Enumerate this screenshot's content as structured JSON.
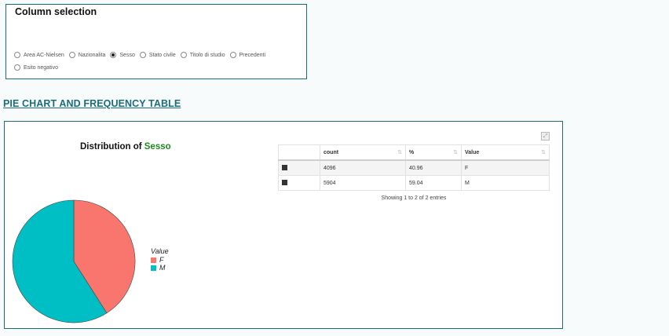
{
  "column_selection": {
    "title": "Column selection",
    "options": [
      {
        "label": "Area AC-Nielsen",
        "selected": false
      },
      {
        "label": "Nazionalita",
        "selected": false
      },
      {
        "label": "Sesso",
        "selected": true
      },
      {
        "label": "Stato civile",
        "selected": false
      },
      {
        "label": "Titolo di studio",
        "selected": false
      },
      {
        "label": "Precedenti",
        "selected": false
      },
      {
        "label": "Esito negativo",
        "selected": false
      }
    ]
  },
  "section_title": "PIE CHART AND FREQUENCY TABLE",
  "chart": {
    "title_prefix": "Distribution of ",
    "title_var": "Sesso",
    "legend_title": "Value",
    "expand_icon": "expand-icon"
  },
  "chart_data": {
    "type": "pie",
    "title": "Distribution of Sesso",
    "legend_title": "Value",
    "legend_placement": "right",
    "slices": [
      {
        "label": "F",
        "value": 4096,
        "percent": 40.96,
        "color": "#f8766d"
      },
      {
        "label": "M",
        "value": 5904,
        "percent": 59.04,
        "color": "#00bfc4"
      }
    ]
  },
  "table": {
    "headers": [
      "",
      "count",
      "%",
      "Value"
    ],
    "rows": [
      {
        "count": "4096",
        "pct": "40.96",
        "value": "F"
      },
      {
        "count": "5904",
        "pct": "59.04",
        "value": "M"
      }
    ],
    "info": "Showing 1 to 2 of 2 entries"
  }
}
